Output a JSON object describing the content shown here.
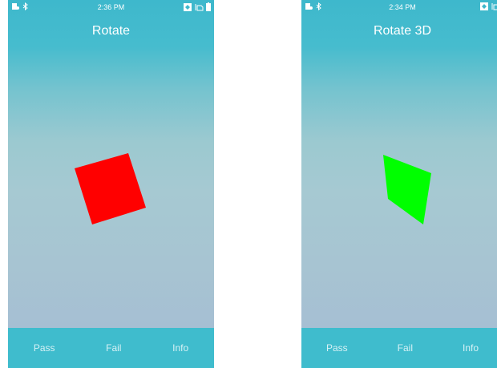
{
  "screens": [
    {
      "status": {
        "time": "2:36 PM"
      },
      "title": "Rotate",
      "shape": {
        "type": "rotated-square",
        "color": "#ff0000"
      },
      "buttons": {
        "pass": "Pass",
        "fail": "Fail",
        "info": "Info"
      },
      "icons": [
        "notification-icon",
        "bluetooth-icon",
        "signal-icon",
        "no-sim-icon",
        "battery-icon"
      ]
    },
    {
      "status": {
        "time": "2:34 PM"
      },
      "title": "Rotate 3D",
      "shape": {
        "type": "rotated-3d-square",
        "color": "#00ff00"
      },
      "buttons": {
        "pass": "Pass",
        "fail": "Fail",
        "info": "Info"
      },
      "icons": [
        "notification-icon",
        "bluetooth-icon",
        "signal-icon",
        "no-sim-icon"
      ]
    }
  ]
}
